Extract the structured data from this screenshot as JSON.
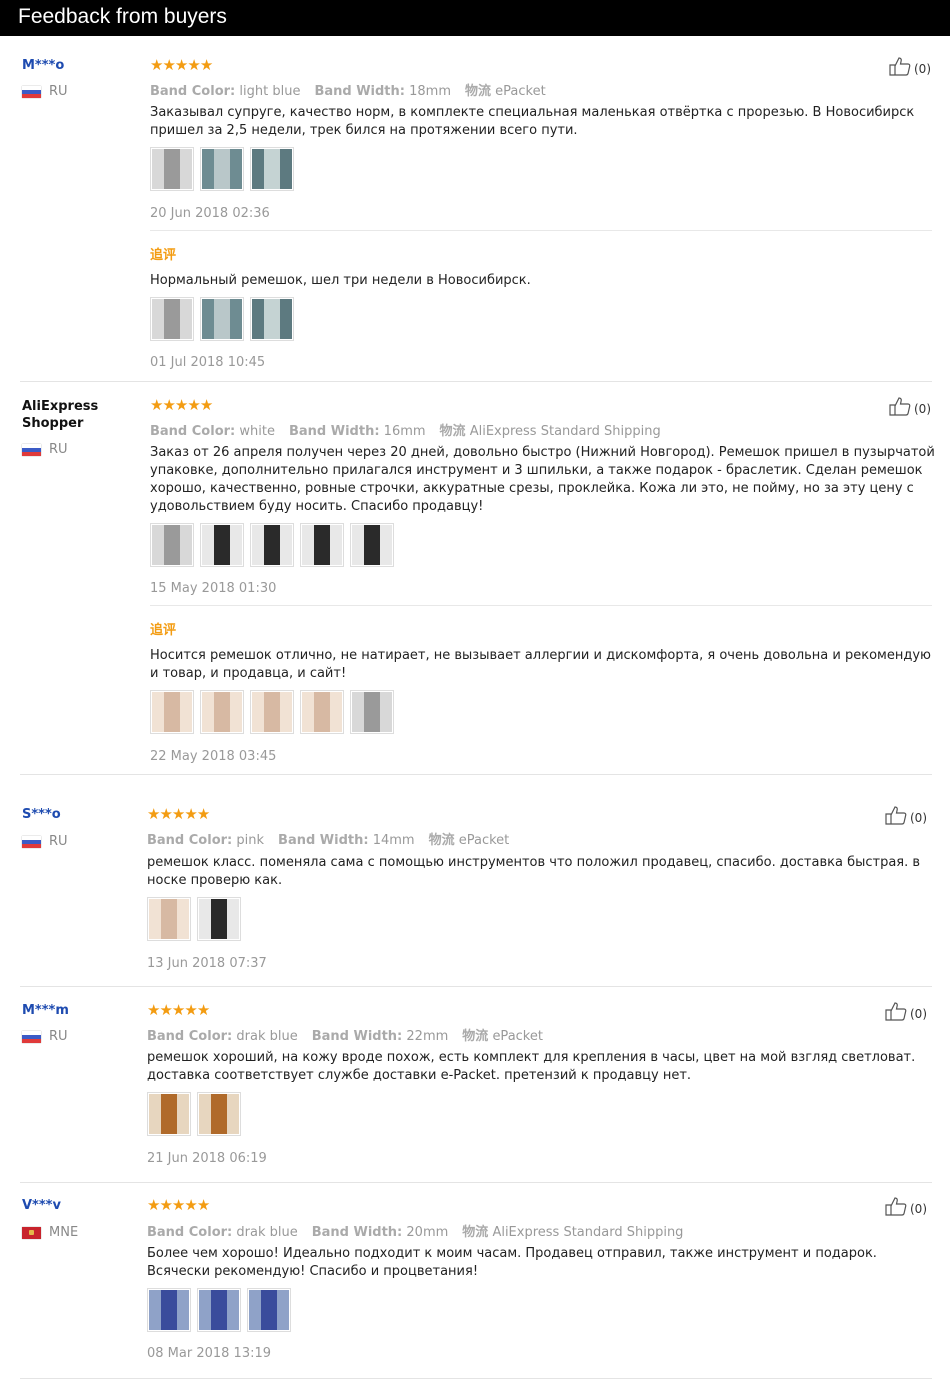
{
  "header": {
    "title": "Feedback from buyers"
  },
  "colors": {
    "star": "#f39c12",
    "name": "#1e4bb0",
    "append": "#f39c12"
  },
  "labels": {
    "color_key": "Band Color:",
    "width_key": "Band Width:",
    "ship_key": "物流",
    "append_label": "追评"
  },
  "reviews": [
    {
      "buyer": "M***o",
      "country": "RU",
      "flag": "ru",
      "stars": 5,
      "likes": "(0)",
      "color": "light blue",
      "width": "18mm",
      "shipping": "ePacket",
      "text": "Заказывал супруге, качество норм, в комплекте специальная маленькая отвёртка с прорезью. В Новосибирск пришел за 2,5 недели, трек бился на протяжении всего пути.",
      "photos": [
        "band-photo",
        "band-photo",
        "band-photo"
      ],
      "date": "20 Jun 2018 02:36",
      "followup": {
        "text": "Нормальный ремешок, шел три недели в Новосибирск.",
        "photos": [
          "band-photo",
          "band-photo",
          "band-photo"
        ],
        "date": "01 Jul 2018 10:45"
      }
    },
    {
      "buyer": "AliExpress Shopper",
      "country": "RU",
      "flag": "ru",
      "stars": 5,
      "likes": "(0)",
      "color": "white",
      "width": "16mm",
      "shipping": "AliExpress Standard Shipping",
      "text": "Заказ от 26 апреля получен через 20 дней, довольно быстро (Нижний Новгород). Ремешок пришел в пузырчатой упаковке, дополнительно прилагался инструмент и 3 шпильки, а также подарок - браслетик. Сделан ремешок хорошо, качественно, ровные строчки, аккуратные срезы, проклейка. Кожа ли это, не пойму, но за эту цену с удовольствием буду носить. Спасибо продавцу!",
      "photos": [
        "band-photo",
        "band-photo",
        "band-photo",
        "band-photo",
        "band-photo"
      ],
      "date": "15 May 2018 01:30",
      "followup": {
        "text": "Носится ремешок отлично, не натирает, не вызывает аллергии и дискомфорта, я очень довольна и рекомендую и товар, и продавца, и сайт!",
        "photos": [
          "band-photo",
          "band-photo",
          "band-photo",
          "band-photo",
          "band-photo"
        ],
        "date": "22 May 2018 03:45"
      }
    },
    {
      "buyer": "S***o",
      "country": "RU",
      "flag": "ru",
      "stars": 5,
      "likes": "(0)",
      "color": "pink",
      "width": "14mm",
      "shipping": "ePacket",
      "text": "ремешок класс. поменяла сама с помощью инструментов что положил продавец, спасибо. доставка быстрая. в носке проверю как.",
      "photos": [
        "band-photo",
        "band-photo"
      ],
      "date": "13 Jun 2018 07:37"
    },
    {
      "buyer": "M***m",
      "country": "RU",
      "flag": "ru",
      "stars": 5,
      "likes": "(0)",
      "color": "drak blue",
      "width": "22mm",
      "shipping": "ePacket",
      "text": "ремешок хороший, на кожу вроде похож, есть комплект для крепления в часы, цвет на мой взгляд светловат. доставка соответствует службе доставки e-Packet. претензий к продавцу нет.",
      "photos": [
        "band-photo",
        "band-photo"
      ],
      "date": "21 Jun 2018 06:19"
    },
    {
      "buyer": "V***v",
      "country": "MNE",
      "flag": "mne",
      "stars": 5,
      "likes": "(0)",
      "color": "drak blue",
      "width": "20mm",
      "shipping": "AliExpress Standard Shipping",
      "text": "Более чем хорошо! Идеально подходит к моим часам. Продавец отправил, также инструмент и подарок. Всячески рекомендую! Спасибо и процветания!",
      "photos": [
        "band-photo",
        "band-photo",
        "band-photo"
      ],
      "date": "08 Mar 2018 13:19"
    }
  ]
}
